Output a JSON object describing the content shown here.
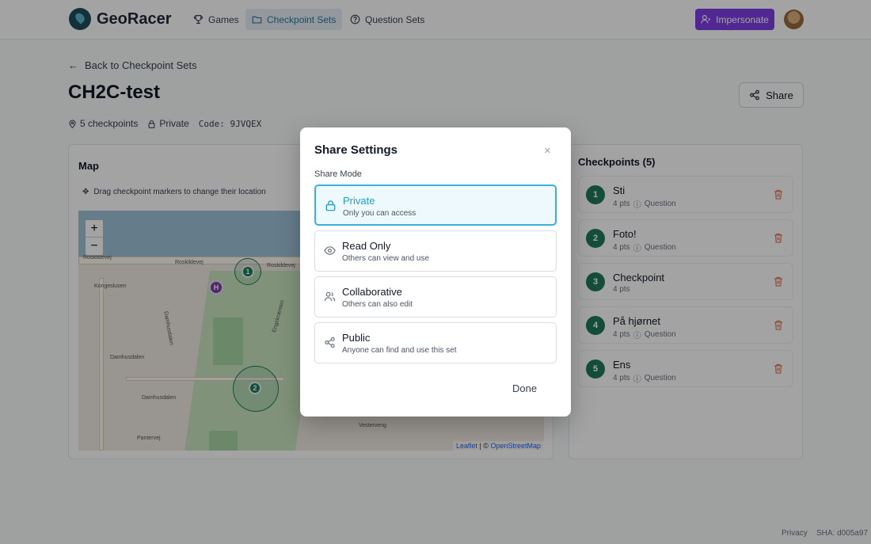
{
  "header": {
    "brand": "GeoRacer",
    "nav": [
      {
        "label": "Games",
        "icon": "trophy-icon"
      },
      {
        "label": "Checkpoint Sets",
        "icon": "folder-icon",
        "active": true
      },
      {
        "label": "Question Sets",
        "icon": "question-circle-icon"
      }
    ],
    "impersonate_label": "Impersonate"
  },
  "page": {
    "back_label": "Back to Checkpoint Sets",
    "title": "CH2C-test",
    "share_label": "Share",
    "meta": {
      "checkpoints": "5 checkpoints",
      "visibility": "Private",
      "code": "Code: 9JVQEX"
    }
  },
  "map": {
    "title": "Map",
    "hint": "Drag checkpoint markers to change their location",
    "zoom_in": "+",
    "zoom_out": "−",
    "markers": [
      "1",
      "2"
    ],
    "poi": "H",
    "streets": [
      "Roskildevej",
      "Roskildevej",
      "Roskildevej",
      "Kongeslusen",
      "Damhusdalen",
      "Damhusdalen",
      "Damhusdalen",
      "Pantervej",
      "Vesterveng",
      "Engskrænten"
    ],
    "attribution_leaflet": "Leaflet",
    "attribution_sep": " | © ",
    "attribution_osm": "OpenStreetMap"
  },
  "checkpoints": {
    "title": "Checkpoints (5)",
    "items": [
      {
        "num": "1",
        "name": "Sti",
        "pts": "4 pts",
        "type": "Question"
      },
      {
        "num": "2",
        "name": "Foto!",
        "pts": "4 pts",
        "type": "Question"
      },
      {
        "num": "3",
        "name": "Checkpoint",
        "pts": "4 pts",
        "type": ""
      },
      {
        "num": "4",
        "name": "På hjørnet",
        "pts": "4 pts",
        "type": "Question"
      },
      {
        "num": "5",
        "name": "Ens",
        "pts": "4 pts",
        "type": "Question"
      }
    ]
  },
  "footer": {
    "privacy": "Privacy",
    "sha": "SHA: d005a97"
  },
  "modal": {
    "title": "Share Settings",
    "close": "×",
    "mode_label": "Share Mode",
    "options": [
      {
        "title": "Private",
        "desc": "Only you can access",
        "icon": "lock-icon",
        "selected": true
      },
      {
        "title": "Read Only",
        "desc": "Others can view and use",
        "icon": "eye-icon"
      },
      {
        "title": "Collaborative",
        "desc": "Others can also edit",
        "icon": "users-icon"
      },
      {
        "title": "Public",
        "desc": "Anyone can find and use this set",
        "icon": "share-icon"
      }
    ],
    "done_label": "Done"
  },
  "colors": {
    "primary_purple": "#7e3ee6",
    "checkpoint_green": "#1f7a5c",
    "selected_blue": "#1d9ec7"
  }
}
